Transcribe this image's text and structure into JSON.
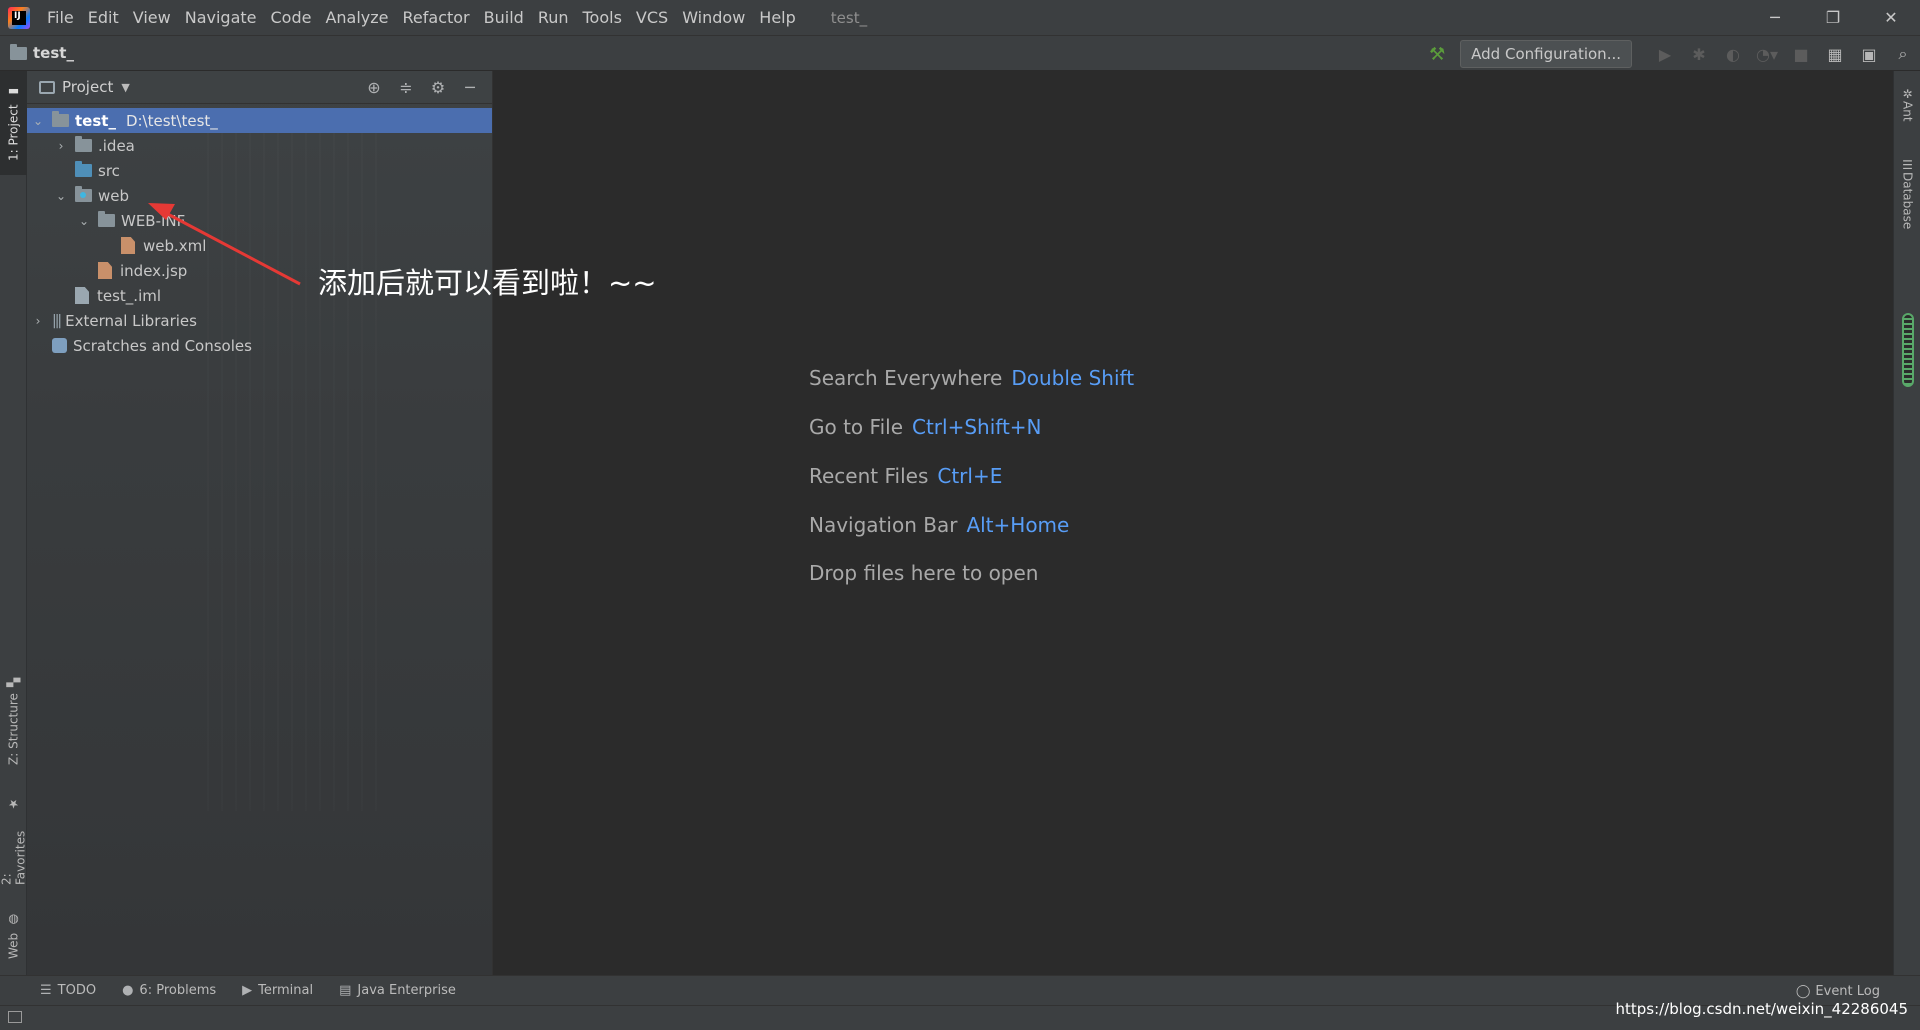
{
  "menubar": {
    "items": [
      "File",
      "Edit",
      "View",
      "Navigate",
      "Code",
      "Analyze",
      "Refactor",
      "Build",
      "Run",
      "Tools",
      "VCS",
      "Window",
      "Help"
    ],
    "window_title": "test_",
    "controls": {
      "minimize": "─",
      "restore": "❐",
      "close": "✕"
    }
  },
  "navbar": {
    "breadcrumb": "test_",
    "add_configuration": "Add Configuration..."
  },
  "left_strip": {
    "project_tab": "1: Project",
    "structure_tab": "Z: Structure",
    "favorites_tab": "2: Favorites",
    "web_tab": "Web"
  },
  "right_strip": {
    "ant_tab": "Ant",
    "database_tab": "Database"
  },
  "project_panel": {
    "title": "Project",
    "tree": {
      "root": {
        "name": "test_",
        "path": "D:\\test\\test_"
      },
      "idea": ".idea",
      "src": "src",
      "web": "web",
      "webinf": "WEB-INF",
      "webxml": "web.xml",
      "indexjsp": "index.jsp",
      "iml": "test_.iml",
      "external_libraries": "External Libraries",
      "scratches": "Scratches and Consoles"
    }
  },
  "annotation": {
    "text": "添加后就可以看到啦！~~",
    "color": "#e53935"
  },
  "editor": {
    "hints": [
      {
        "label": "Search Everywhere",
        "key": "Double Shift"
      },
      {
        "label": "Go to File",
        "key": "Ctrl+Shift+N"
      },
      {
        "label": "Recent Files",
        "key": "Ctrl+E"
      },
      {
        "label": "Navigation Bar",
        "key": "Alt+Home"
      }
    ],
    "drop_text": "Drop files here to open"
  },
  "bottom_bar": {
    "todo": "TODO",
    "problems": "6: Problems",
    "terminal": "Terminal",
    "java_enterprise": "Java Enterprise",
    "event_log": "Event Log"
  },
  "watermark": "https://blog.csdn.net/weixin_42286045"
}
